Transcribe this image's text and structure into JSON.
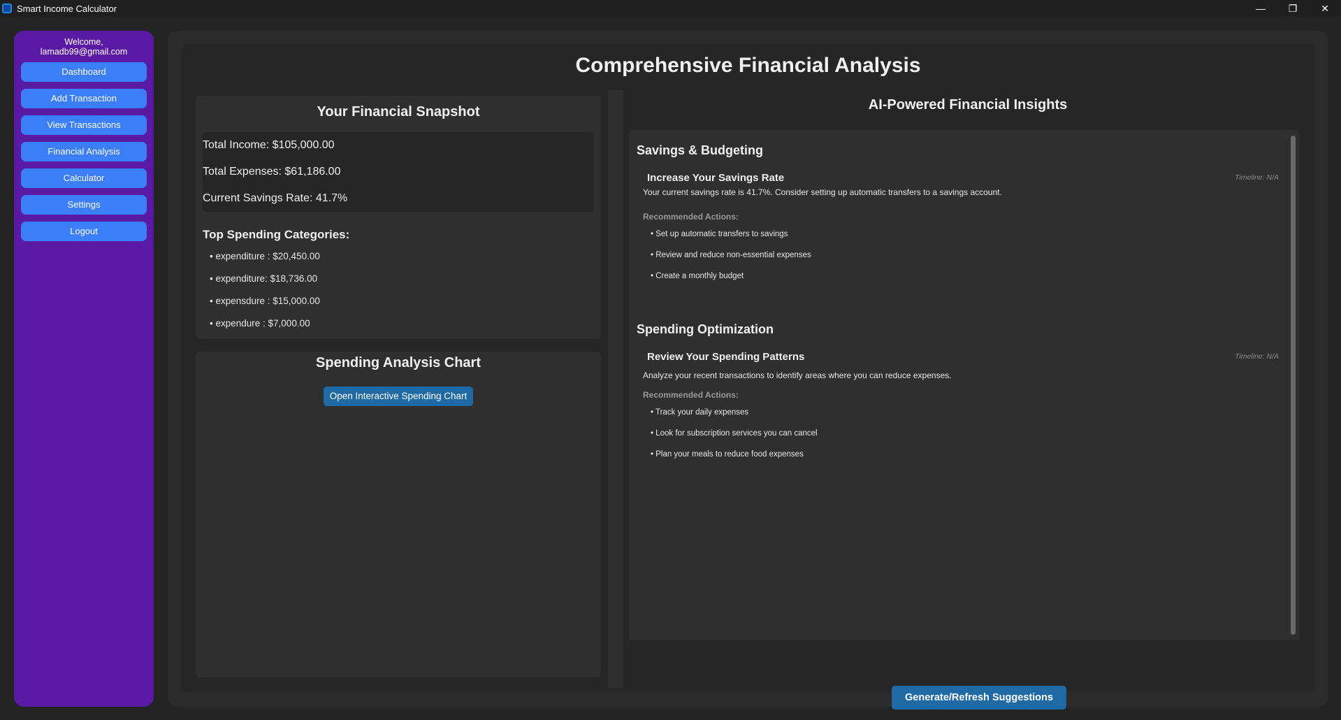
{
  "window": {
    "title": "Smart Income Calculator",
    "controls": {
      "minimize": "—",
      "restore": "❐",
      "close": "✕"
    }
  },
  "sidebar": {
    "welcome_line1": "Welcome,",
    "welcome_line2": "lamadb99@gmail.com",
    "items": [
      {
        "label": "Dashboard"
      },
      {
        "label": "Add Transaction"
      },
      {
        "label": "View Transactions"
      },
      {
        "label": "Financial Analysis"
      },
      {
        "label": "Calculator"
      },
      {
        "label": "Settings"
      },
      {
        "label": "Logout"
      }
    ]
  },
  "page": {
    "title": "Comprehensive Financial Analysis"
  },
  "snapshot": {
    "title": "Your Financial Snapshot",
    "total_income": "Total Income: $105,000.00",
    "total_expenses": "Total Expenses: $61,186.00",
    "savings_rate": "Current Savings Rate: 41.7%",
    "top_categories_title": "Top Spending Categories:",
    "categories": [
      "• expenditure : $20,450.00",
      "• expenditure: $18,736.00",
      "• expensdure : $15,000.00",
      "• expendure : $7,000.00"
    ]
  },
  "chart_section": {
    "title": "Spending Analysis Chart",
    "button_label": "Open Interactive Spending Chart"
  },
  "insights": {
    "title": "AI-Powered Financial Insights",
    "sections": [
      {
        "heading": "Savings & Budgeting",
        "insight_title": "Increase Your Savings Rate",
        "timeline": "Timeline: N/A",
        "description": "Your current savings rate is 41.7%. Consider setting up automatic transfers to a savings account.",
        "rec_label": "Recommended Actions:",
        "actions": [
          "• Set up automatic transfers to savings",
          "• Review and reduce non-essential expenses",
          "• Create a monthly budget"
        ]
      },
      {
        "heading": "Spending Optimization",
        "insight_title": "Review Your Spending Patterns",
        "timeline": "Timeline: N/A",
        "description": "Analyze your recent transactions to identify areas where you can reduce expenses.",
        "rec_label": "Recommended Actions:",
        "actions": [
          "• Track your daily expenses",
          "• Look for subscription services you can cancel",
          "• Plan your meals to reduce food expenses"
        ]
      }
    ],
    "generate_button": "Generate/Refresh Suggestions"
  },
  "colors": {
    "sidebar_bg": "#5b1aa3",
    "nav_button": "#3b7ef7",
    "accent_button": "#1f6aa5",
    "background": "#242424"
  }
}
